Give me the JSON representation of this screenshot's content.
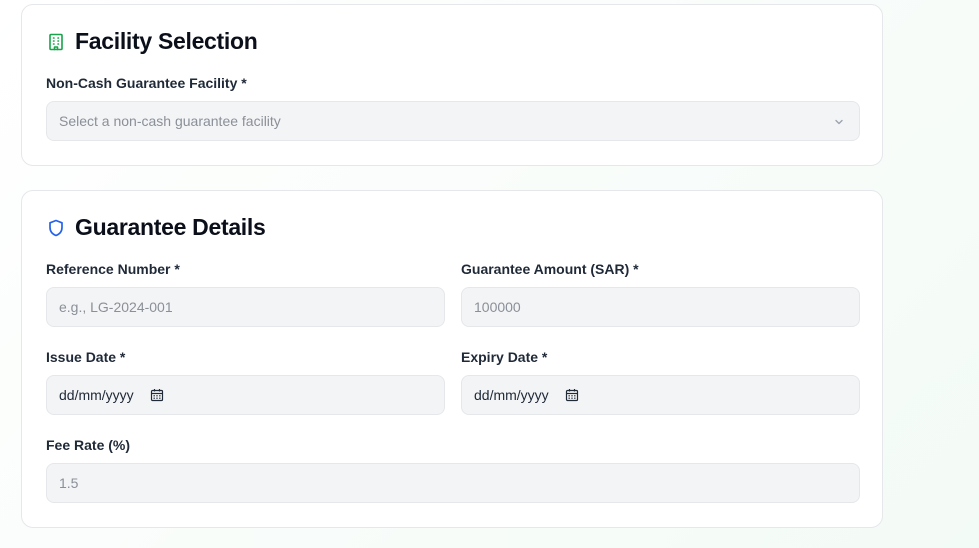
{
  "facility_section": {
    "title": "Facility Selection",
    "icon": "building-icon",
    "facility_label": "Non-Cash Guarantee Facility *",
    "facility_placeholder": "Select a non-cash guarantee facility"
  },
  "details_section": {
    "title": "Guarantee Details",
    "icon": "shield-icon",
    "reference_label": "Reference Number *",
    "reference_placeholder": "e.g., LG-2024-001",
    "amount_label": "Guarantee Amount (SAR) *",
    "amount_placeholder": "100000",
    "issue_label": "Issue Date *",
    "issue_value": "dd/mm/yyyy",
    "expiry_label": "Expiry Date *",
    "expiry_value": "dd/mm/yyyy",
    "fee_label": "Fee Rate (%)",
    "fee_placeholder": "1.5"
  },
  "colors": {
    "building_icon": "#16a34a",
    "shield_icon": "#2563eb",
    "field_bg": "#f3f4f6",
    "border": "#e5e7eb"
  }
}
